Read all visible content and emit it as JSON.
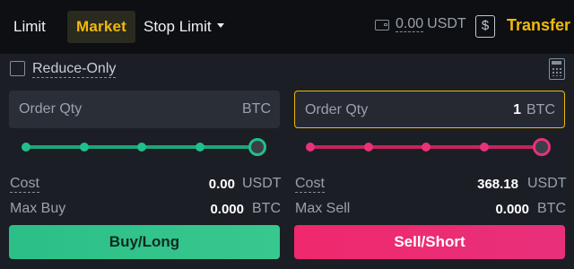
{
  "tabs": {
    "limit": "Limit",
    "market": "Market",
    "stop_limit": "Stop Limit"
  },
  "balance": {
    "amount": "0.00",
    "currency": "USDT"
  },
  "transfer_label": "Transfer",
  "transfer_icon_glyph": "$",
  "reduce_only": {
    "label": "Reduce-Only",
    "checked": false
  },
  "buy": {
    "order_qty_placeholder": "Order Qty",
    "unit": "BTC",
    "value": "",
    "slider_percent": 100,
    "cost_label": "Cost",
    "cost_value": "0.00",
    "cost_unit": "USDT",
    "max_label": "Max Buy",
    "max_value": "0.000",
    "max_unit": "BTC",
    "button_label": "Buy/Long"
  },
  "sell": {
    "order_qty_placeholder": "Order Qty",
    "unit": "BTC",
    "value": "1",
    "slider_percent": 100,
    "cost_label": "Cost",
    "cost_value": "368.18",
    "cost_unit": "USDT",
    "max_label": "Max Sell",
    "max_value": "0.000",
    "max_unit": "BTC",
    "button_label": "Sell/Short"
  },
  "colors": {
    "accent": "#f0b90b",
    "buy": "#2ebd85",
    "sell": "#f0286d",
    "background": "#1b1e25"
  }
}
